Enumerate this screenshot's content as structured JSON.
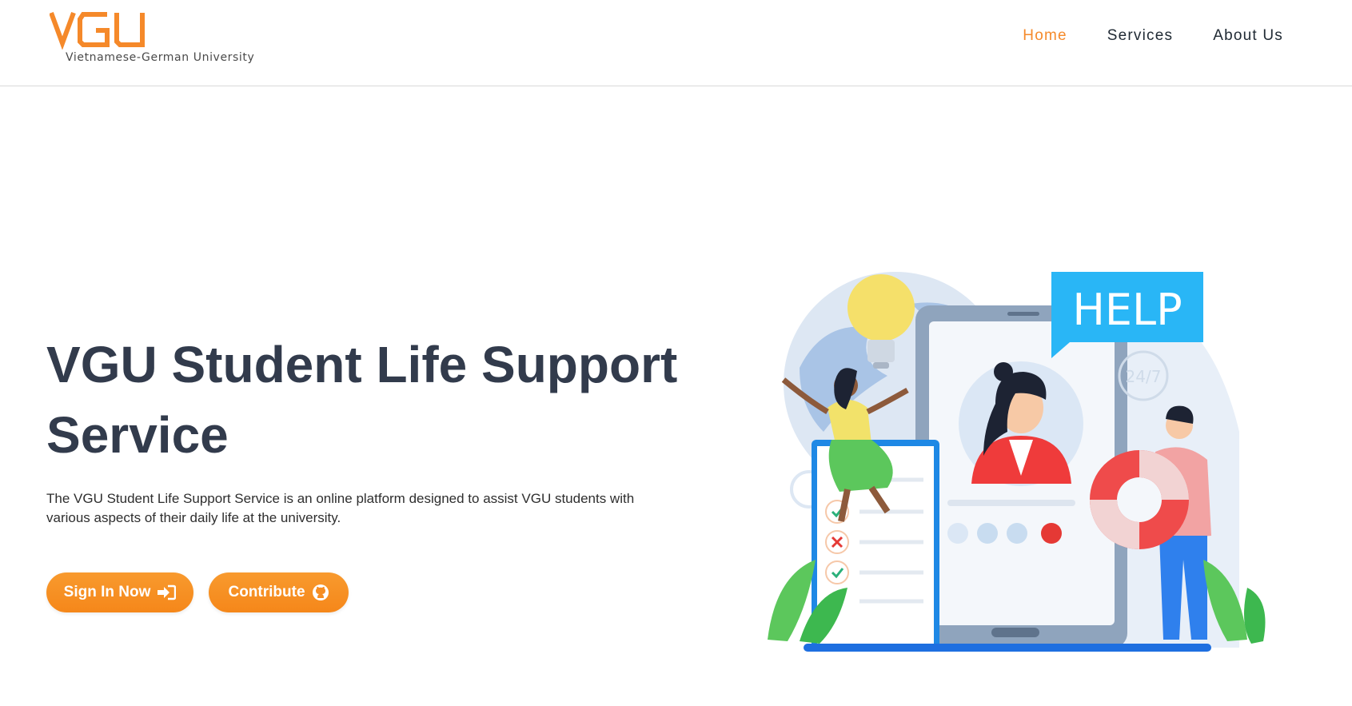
{
  "header": {
    "logo_text": "VGU",
    "logo_subtitle": "Vietnamese-German University",
    "nav": [
      {
        "label": "Home",
        "active": true
      },
      {
        "label": "Services",
        "active": false
      },
      {
        "label": "About Us",
        "active": false
      }
    ]
  },
  "hero": {
    "title_line1": "VGU Student Life Support",
    "title_line2": "Service",
    "description_line1": "The VGU Student Life Support Service is an online platform designed to assist VGU students with",
    "description_line2": "various aspects of their daily life at the university.",
    "buttons": {
      "signin_label": "Sign In Now",
      "signin_icon": "sign-in-icon",
      "contribute_label": "Contribute",
      "contribute_icon": "github-icon"
    }
  },
  "illustration": {
    "help_text": "HELP",
    "badge_text": "24/7"
  },
  "colors": {
    "accent": "#f58a2b",
    "button": "#f7901e",
    "title": "#323b4c",
    "help_blue": "#29b6f6"
  }
}
